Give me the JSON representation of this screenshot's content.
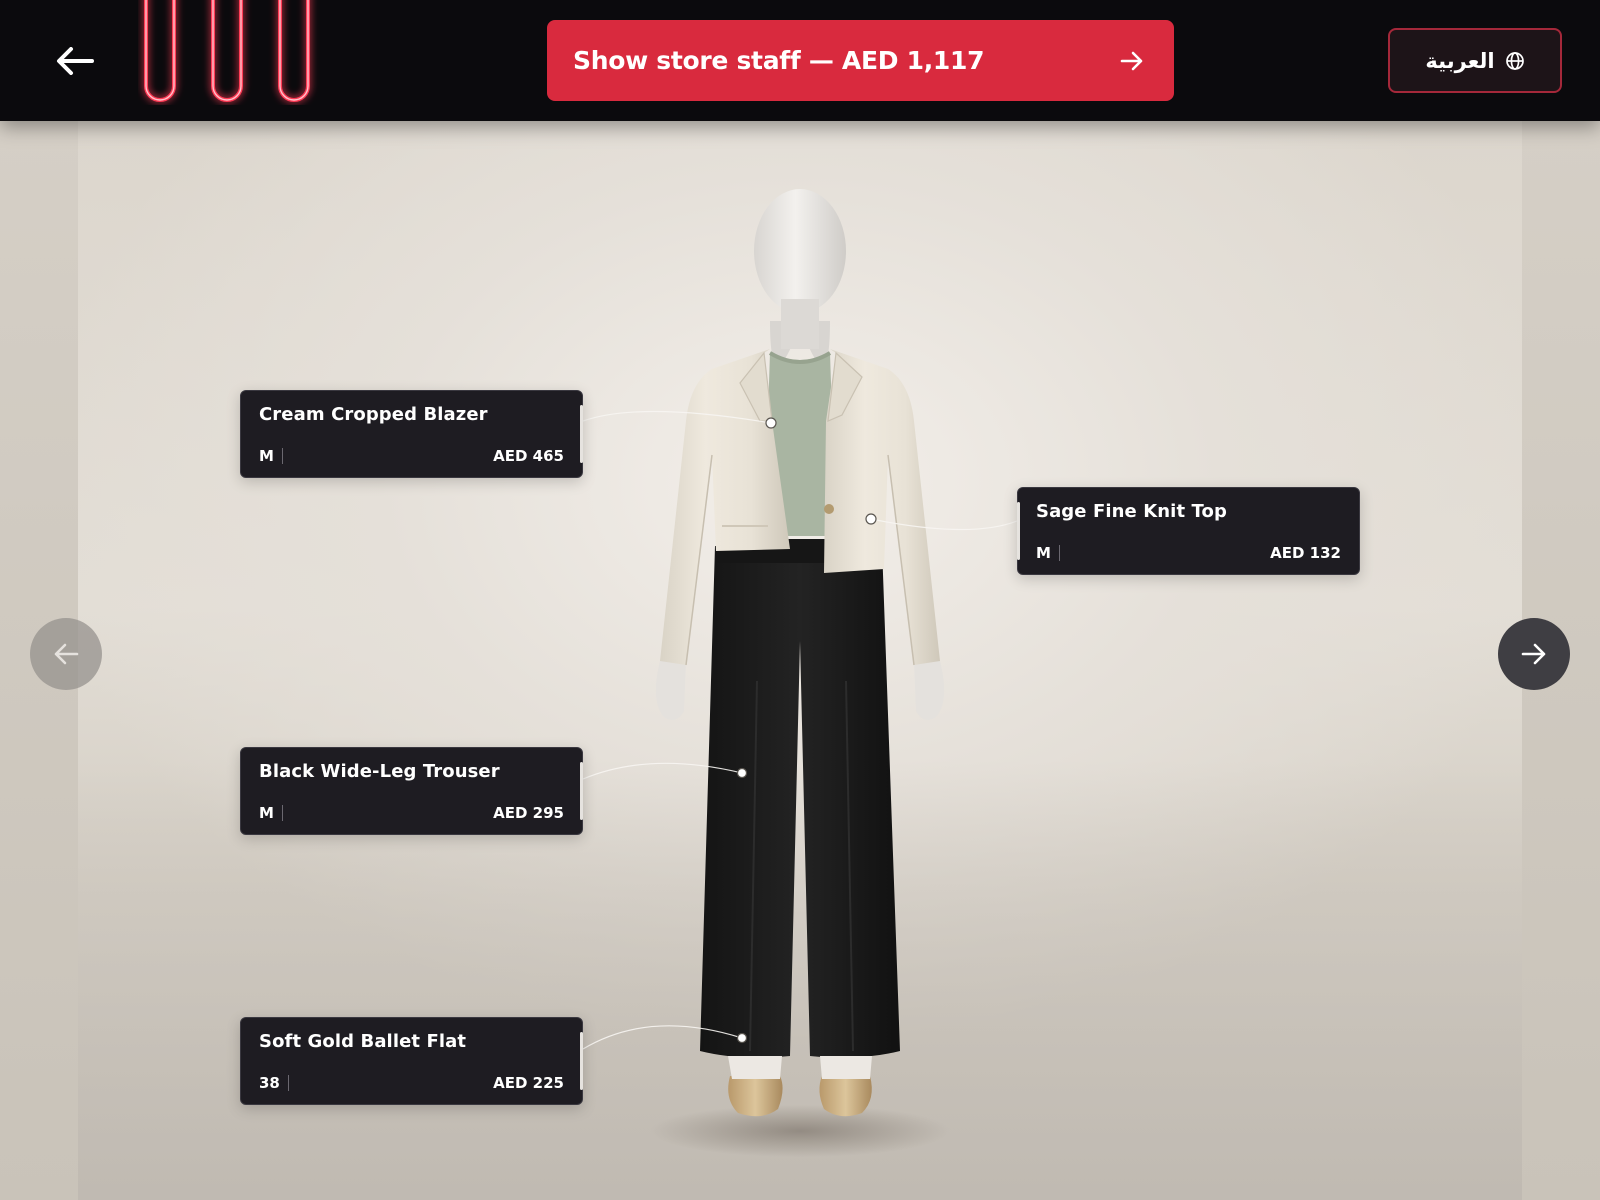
{
  "header": {
    "cta_label": "Show store staff — AED 1,117",
    "language_label": "العربية"
  },
  "products": [
    {
      "name": "Cream Cropped Blazer",
      "size": "M",
      "price": "AED 465"
    },
    {
      "name": "Sage Fine Knit Top",
      "size": "M",
      "price": "AED 132"
    },
    {
      "name": "Black Wide-Leg Trouser",
      "size": "M",
      "price": "AED 295"
    },
    {
      "name": "Soft Gold Ballet Flat",
      "size": "38",
      "price": "AED 225"
    }
  ],
  "colors": {
    "accent": "#d92a3e",
    "topbar": "#0b0a0d",
    "card": "#1e1c22",
    "neon": "#e83a52"
  },
  "icons": {
    "back": "arrow-left-icon",
    "cta": "arrow-right-icon",
    "language": "globe-icon",
    "prev": "arrow-left-icon",
    "next": "arrow-right-icon"
  }
}
